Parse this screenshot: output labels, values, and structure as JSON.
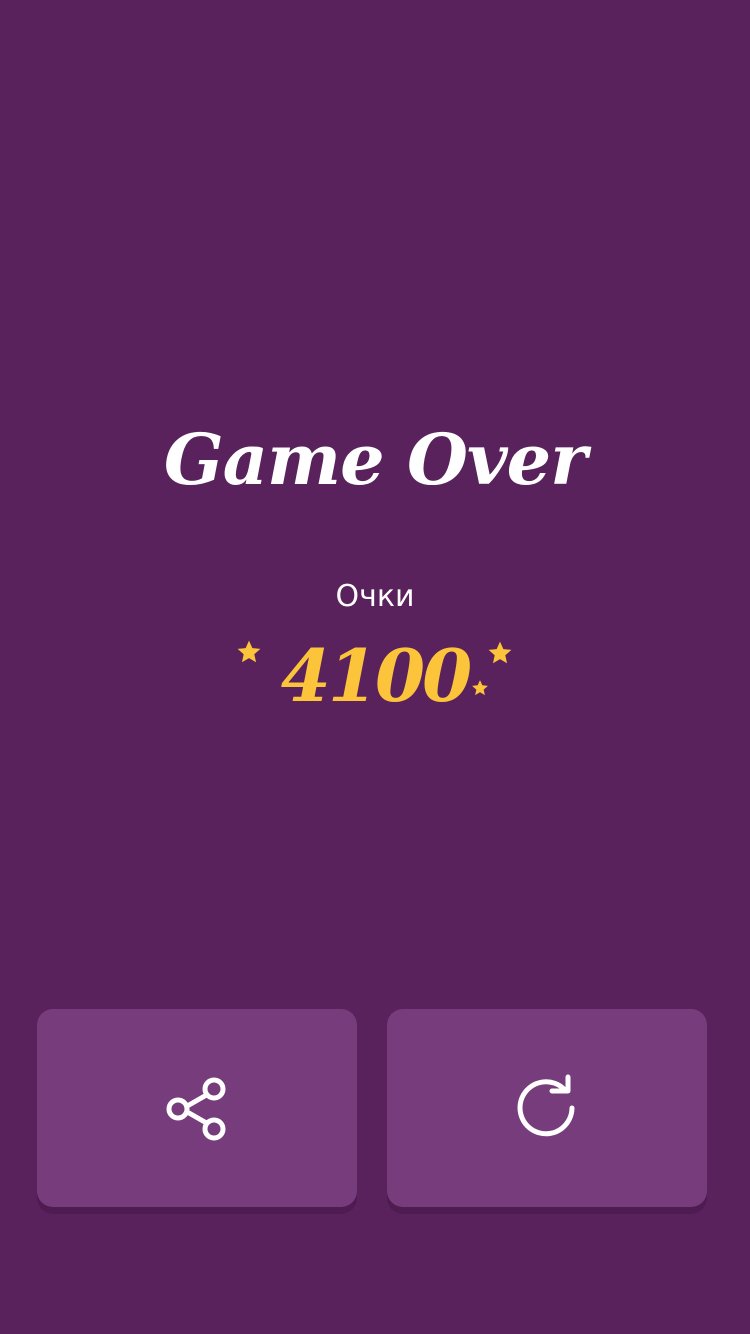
{
  "screen": {
    "title": "Game Over",
    "score_label": "Очки",
    "score_value": "4100"
  },
  "buttons": {
    "share_icon": "share-icon",
    "restart_icon": "restart-icon"
  },
  "colors": {
    "background": "#5a225c",
    "button": "#763c7b",
    "score": "#fcc43a",
    "text": "#ffffff"
  }
}
